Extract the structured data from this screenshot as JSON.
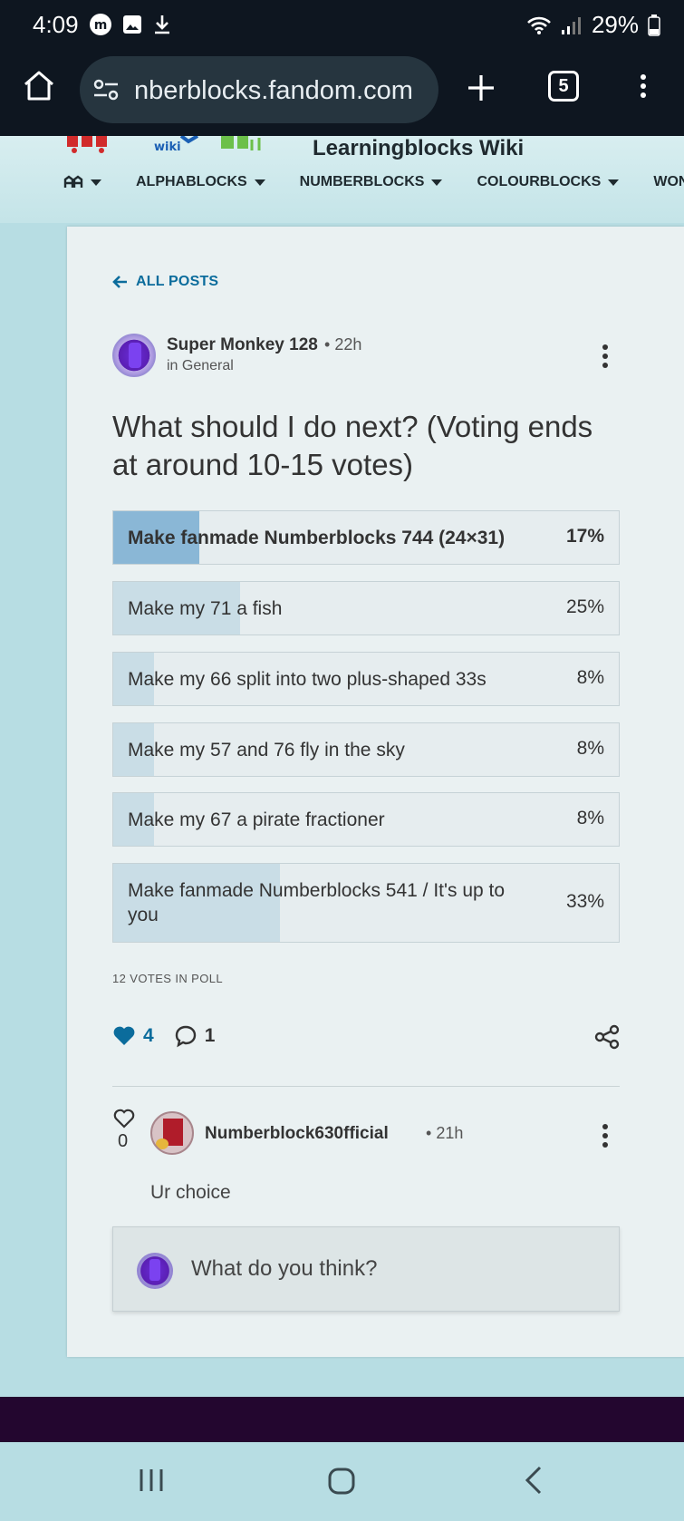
{
  "status_bar": {
    "time": "4:09",
    "battery": "29%",
    "icons": [
      "messenger-icon",
      "gallery-icon",
      "download-icon",
      "wifi-icon",
      "signal-icon",
      "battery-icon"
    ]
  },
  "browser": {
    "url": "nberblocks.fandom.com",
    "tab_count": "5"
  },
  "site": {
    "wiki_title": "Learningblocks Wiki",
    "nav": [
      "ALPHABLOCKS",
      "NUMBERBLOCKS",
      "COLOURBLOCKS",
      "WON"
    ]
  },
  "post": {
    "back_label": "ALL POSTS",
    "author": "Super Monkey 128",
    "time": "22h",
    "category": "in General",
    "title": "What should I do next? (Voting ends at around 10-15 votes)",
    "poll": {
      "options": [
        {
          "label": "Make fanmade Numberblocks 744 (24×31)",
          "percent_text": "17%",
          "percent": 17,
          "selected": true
        },
        {
          "label": "Make my 71 a fish",
          "percent_text": "25%",
          "percent": 25,
          "selected": false
        },
        {
          "label": "Make my 66 split into two plus-shaped 33s",
          "percent_text": "8%",
          "percent": 8,
          "selected": false
        },
        {
          "label": "Make my 57 and 76 fly in the sky",
          "percent_text": "8%",
          "percent": 8,
          "selected": false
        },
        {
          "label": "Make my 67 a pirate fractioner",
          "percent_text": "8%",
          "percent": 8,
          "selected": false
        },
        {
          "label": "Make fanmade Numberblocks 541 / It's up to you",
          "percent_text": "33%",
          "percent": 33,
          "selected": false
        }
      ],
      "votes_label": "12 VOTES IN POLL"
    },
    "likes": "4",
    "comments": "1"
  },
  "reply": {
    "likes": "0",
    "author": "Numberblock630fficial",
    "time": "21h",
    "body": "Ur choice"
  },
  "comment_box": {
    "placeholder": "What do you think?"
  },
  "colors": {
    "accent": "#0b6c9c",
    "poll_fill": "#c9dde6",
    "poll_fill_selected": "#8ab7d6",
    "footer": "#23062f"
  }
}
